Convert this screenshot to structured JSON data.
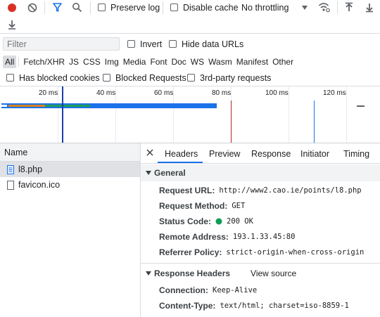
{
  "toolbar": {
    "record_icon": "record-icon",
    "preserve_log_label": "Preserve log",
    "disable_cache_label": "Disable cache",
    "throttling_value": "No throttling"
  },
  "filter": {
    "placeholder": "Filter",
    "invert_label": "Invert",
    "hide_data_urls_label": "Hide data URLs"
  },
  "type_filters": [
    "All",
    "Fetch/XHR",
    "JS",
    "CSS",
    "Img",
    "Media",
    "Font",
    "Doc",
    "WS",
    "Wasm",
    "Manifest",
    "Other"
  ],
  "blocked": {
    "has_blocked_cookies": "Has blocked cookies",
    "blocked_requests": "Blocked Requests",
    "third_party": "3rd-party requests"
  },
  "timeline": {
    "ticks": [
      "20 ms",
      "40 ms",
      "60 ms",
      "80 ms",
      "100 ms",
      "120 ms"
    ]
  },
  "requests": {
    "header": "Name",
    "items": [
      {
        "name": "l8.php"
      },
      {
        "name": "favicon.ico"
      }
    ]
  },
  "detail_tabs": [
    "Headers",
    "Preview",
    "Response",
    "Initiator",
    "Timing"
  ],
  "general": {
    "title": "General",
    "request_url_key": "Request URL:",
    "request_url": "http://www2.cao.ie/points/l8.php",
    "request_method_key": "Request Method:",
    "request_method": "GET",
    "status_code_key": "Status Code:",
    "status_code": "200 OK",
    "remote_address_key": "Remote Address:",
    "remote_address": "193.1.33.45:80",
    "referrer_policy_key": "Referrer Policy:",
    "referrer_policy": "strict-origin-when-cross-origin"
  },
  "response_headers": {
    "title": "Response Headers",
    "view_source": "View source",
    "connection_key": "Connection:",
    "connection": "Keep-Alive",
    "content_type_key": "Content-Type:",
    "content_type": "text/html; charset=iso-8859-1"
  },
  "colors": {
    "accent": "#1a73e8",
    "record": "#d93025",
    "status_ok": "#0f9d58"
  }
}
